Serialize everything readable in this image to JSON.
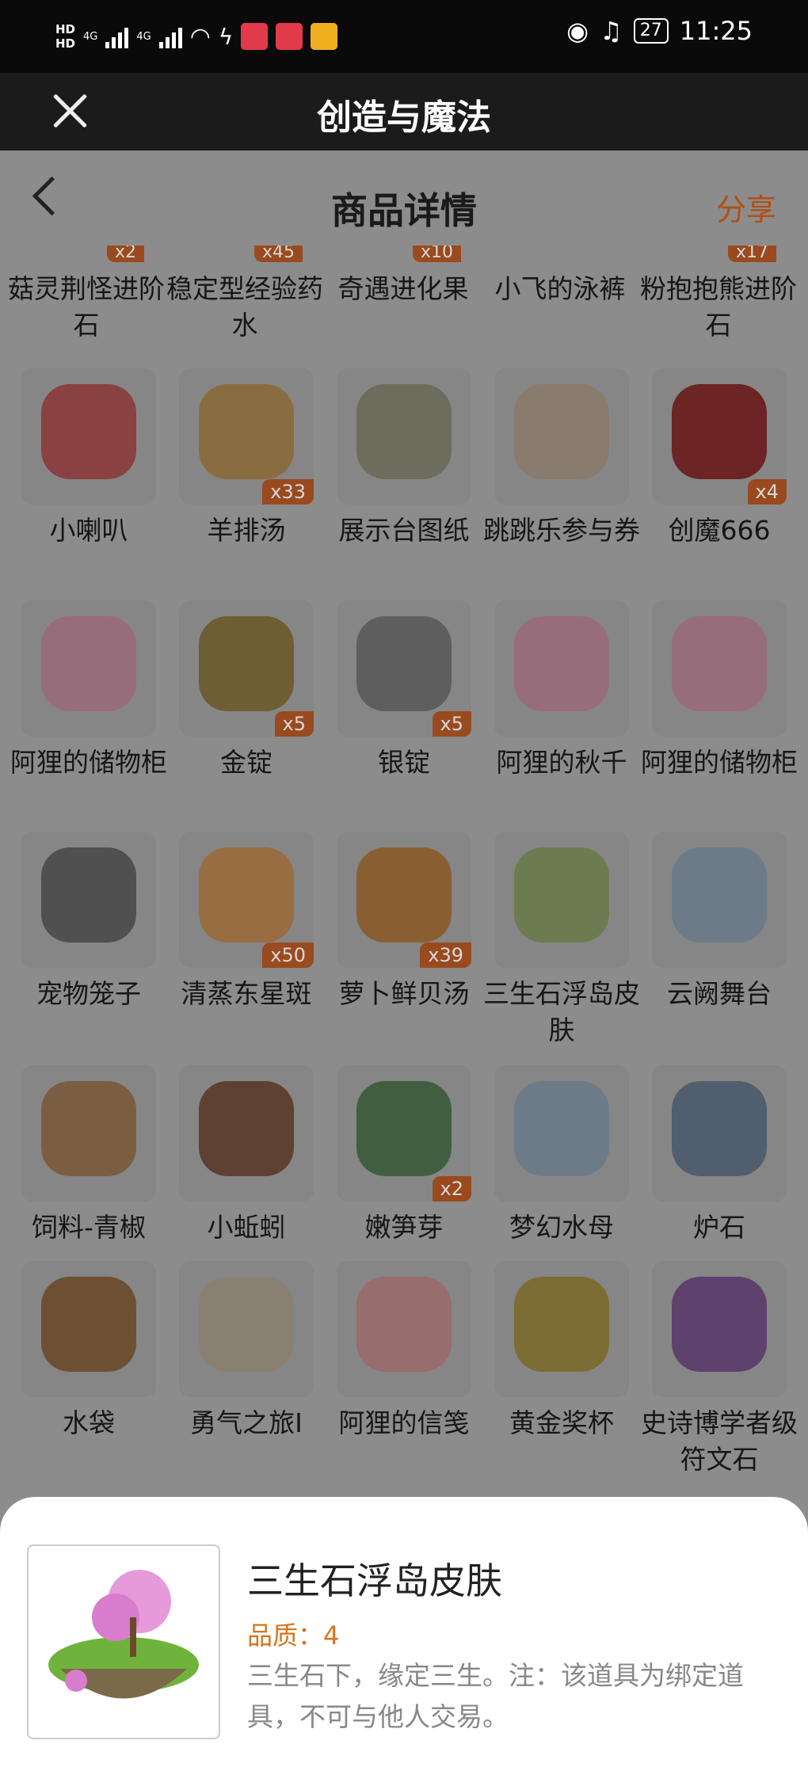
{
  "status_bar": {
    "hd1": "HD",
    "hd2": "HD",
    "network1": "4G",
    "network2": "4G",
    "battery": "27",
    "time": "11:25"
  },
  "app": {
    "title": "创造与魔法"
  },
  "page": {
    "title": "商品详情",
    "share_label": "分享"
  },
  "top_row": [
    {
      "name": "菇灵荆怪进阶石",
      "count": "x2"
    },
    {
      "name": "稳定型经验药水",
      "count": "x45"
    },
    {
      "name": "奇遇进化果",
      "count": "x10"
    },
    {
      "name": "小飞的泳裤",
      "count": ""
    },
    {
      "name": "粉抱抱熊进阶石",
      "count": "x17"
    }
  ],
  "rows": [
    [
      {
        "name": "小喇叭",
        "count": "",
        "color": "#8a3a3a"
      },
      {
        "name": "羊排汤",
        "count": "x33",
        "color": "#8a6a3a"
      },
      {
        "name": "展示台图纸",
        "count": "",
        "color": "#6a6a5a"
      },
      {
        "name": "跳跳乐参与券",
        "count": "",
        "color": "#8a7a6a"
      },
      {
        "name": "创魔666",
        "count": "x4",
        "color": "#6a1a1a"
      }
    ],
    [
      {
        "name": "阿狸的储物柜",
        "count": "",
        "color": "#9a6a7a"
      },
      {
        "name": "金锭",
        "count": "x5",
        "color": "#6a5a2a"
      },
      {
        "name": "银锭",
        "count": "x5",
        "color": "#5a5a5a"
      },
      {
        "name": "阿狸的秋千",
        "count": "",
        "color": "#9a6a7a"
      },
      {
        "name": "阿狸的储物柜",
        "count": "",
        "color": "#9a6a7a"
      }
    ],
    [
      {
        "name": "宠物笼子",
        "count": "",
        "color": "#4a4a4a"
      },
      {
        "name": "清蒸东星斑",
        "count": "x50",
        "color": "#9a6a3a"
      },
      {
        "name": "萝卜鲜贝汤",
        "count": "x39",
        "color": "#8a5a2a"
      },
      {
        "name": "三生石浮岛皮肤",
        "count": "",
        "color": "#6a7a4a"
      },
      {
        "name": "云阙舞台",
        "count": "",
        "color": "#6a7a8a"
      }
    ],
    [
      {
        "name": "饲料-青椒",
        "count": "",
        "color": "#7a5a3a"
      },
      {
        "name": "小蚯蚓",
        "count": "",
        "color": "#5a3a2a"
      },
      {
        "name": "嫩笋芽",
        "count": "x2",
        "color": "#3a5a3a"
      },
      {
        "name": "梦幻水母",
        "count": "",
        "color": "#6a7a8a"
      },
      {
        "name": "炉石",
        "count": "",
        "color": "#4a5a6a"
      }
    ],
    [
      {
        "name": "水袋",
        "count": "",
        "color": "#6a4a2a"
      },
      {
        "name": "勇气之旅I",
        "count": "",
        "color": "#8a8070"
      },
      {
        "name": "阿狸的信笺",
        "count": "",
        "color": "#9a6a6a"
      },
      {
        "name": "黄金奖杯",
        "count": "",
        "color": "#7a6a2a"
      },
      {
        "name": "史诗博学者级符文石",
        "count": "",
        "color": "#5a3a6a"
      }
    ]
  ],
  "detail": {
    "name": "三生石浮岛皮肤",
    "quality": "品质：4",
    "description": "三生石下，缘定三生。注：该道具为绑定道具，不可与他人交易。"
  }
}
